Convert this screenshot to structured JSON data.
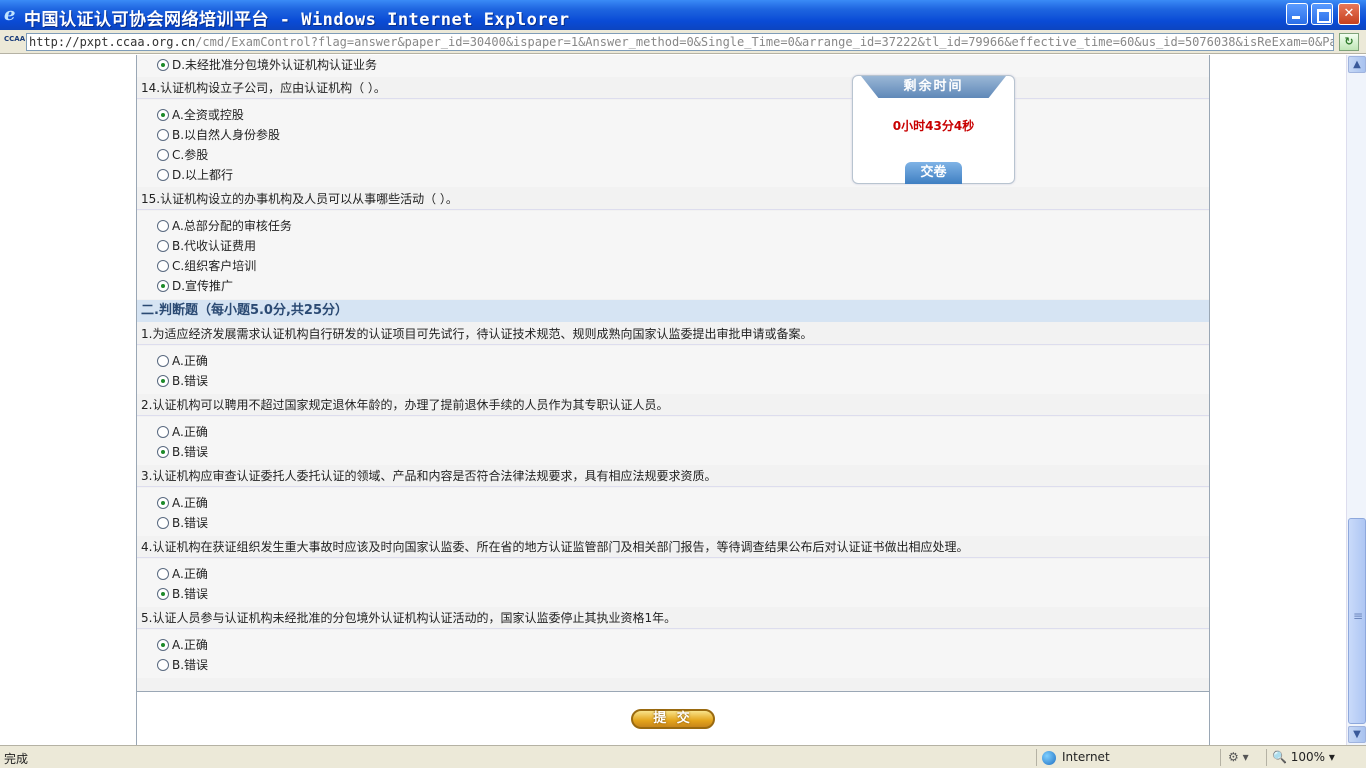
{
  "window": {
    "title": "中国认证认可协会网络培训平台 - Windows Internet Explorer",
    "minimize": "",
    "maximize": "",
    "close": "✕"
  },
  "address": {
    "favicon": "CCAA",
    "host": "http://pxpt.ccaa.org.cn",
    "path": "/cmd/ExamControl?flag=answer&paper_id=30400&ispaper=1&Answer_method=0&Single_Time=0&arrange_id=37222&tl_id=79966&effective_time=60&us_id=5076038&isReExam=0&PaperDi"
  },
  "timer": {
    "header": "剩余时间",
    "remaining": "0小时43分4秒",
    "handin_label": "交卷"
  },
  "exam": {
    "q13_partial": {
      "option_d": "D.未经批准分包境外认证机构认证业务",
      "selected": "D"
    },
    "q14": {
      "text": "14.认证机构设立子公司，应由认证机构（ ）。",
      "options": [
        "A.全资或控股",
        "B.以自然人身份参股",
        "C.参股",
        "D.以上都行"
      ],
      "selected": "A"
    },
    "q15": {
      "text": "15.认证机构设立的办事机构及人员可以从事哪些活动（ ）。",
      "options": [
        "A.总部分配的审核任务",
        "B.代收认证费用",
        "C.组织客户培训",
        "D.宣传推广"
      ],
      "selected": "D"
    },
    "section2_title": "二.判断题（每小题5.0分,共25分）",
    "tf": [
      {
        "text": "1.为适应经济发展需求认证机构自行研发的认证项目可先试行，待认证技术规范、规则成熟向国家认监委提出审批申请或备案。",
        "options": [
          "A.正确",
          "B.错误"
        ],
        "selected": "B"
      },
      {
        "text": "2.认证机构可以聘用不超过国家规定退休年龄的，办理了提前退休手续的人员作为其专职认证人员。",
        "options": [
          "A.正确",
          "B.错误"
        ],
        "selected": "B"
      },
      {
        "text": "3.认证机构应审查认证委托人委托认证的领域、产品和内容是否符合法律法规要求，具有相应法规要求资质。",
        "options": [
          "A.正确",
          "B.错误"
        ],
        "selected": "A"
      },
      {
        "text": "4.认证机构在获证组织发生重大事故时应该及时向国家认监委、所在省的地方认证监管部门及相关部门报告，等待调查结果公布后对认证证书做出相应处理。",
        "options": [
          "A.正确",
          "B.错误"
        ],
        "selected": "B"
      },
      {
        "text": "5.认证人员参与认证机构未经批准的分包境外认证机构认证活动的，国家认监委停止其执业资格1年。",
        "options": [
          "A.正确",
          "B.错误"
        ],
        "selected": "A"
      }
    ],
    "submit_label": "提 交"
  },
  "status": {
    "text": "完成",
    "zone": "Internet",
    "protected_icon": "⚙ ▾",
    "zoom": "🔍 100%  ▾"
  }
}
